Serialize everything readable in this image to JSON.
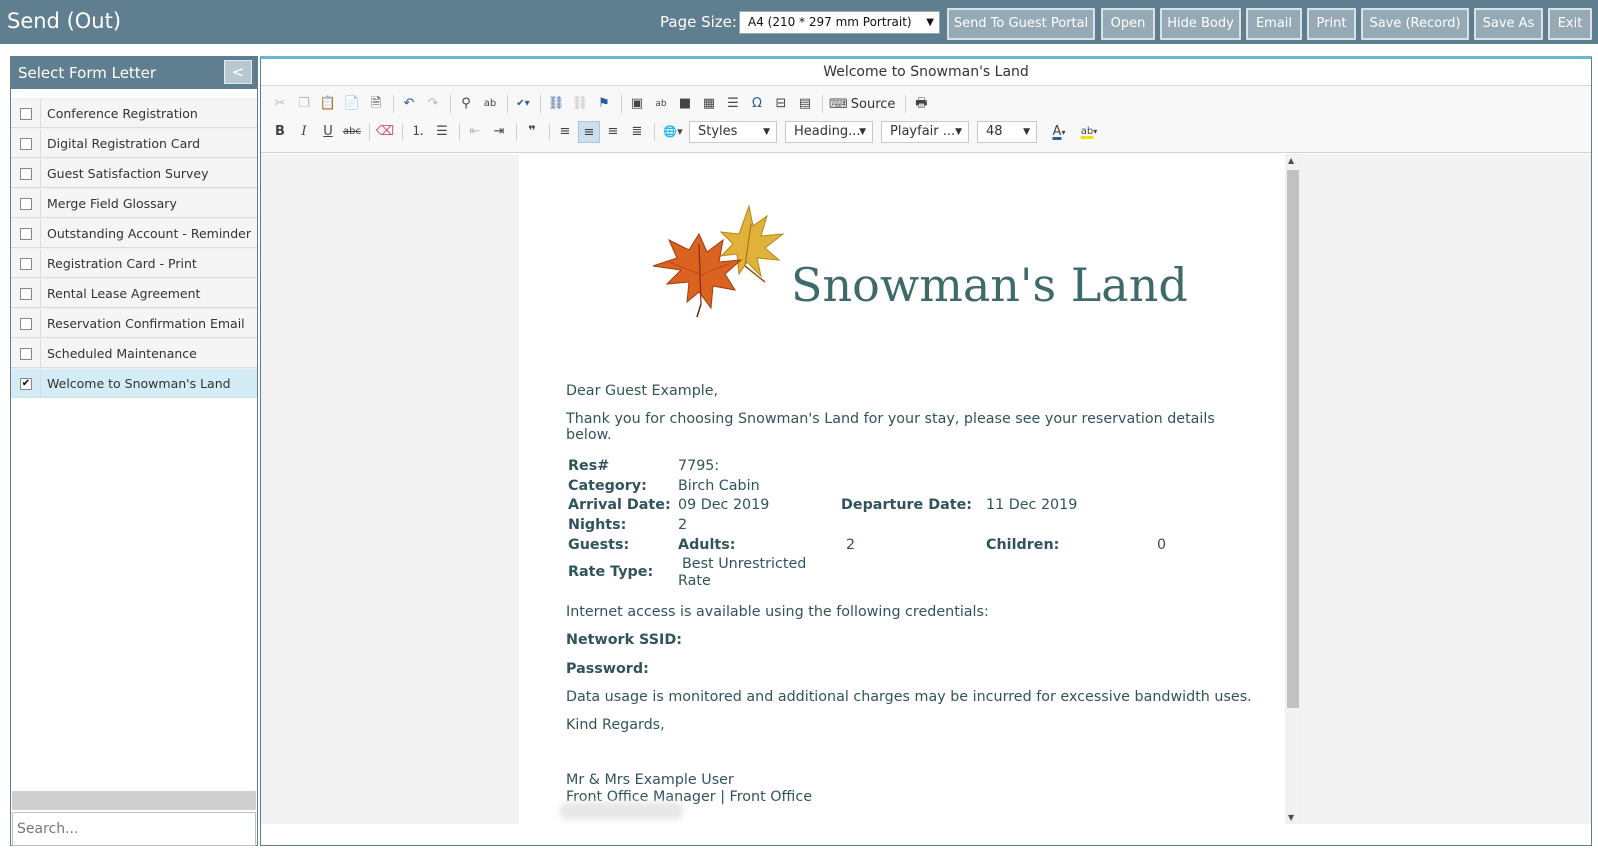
{
  "app": {
    "title": "Send (Out)"
  },
  "header": {
    "page_size_label": "Page Size:",
    "page_size_value": "A4 (210 * 297 mm Portrait)",
    "buttons": {
      "send_to_guest_portal": "Send To Guest Portal",
      "open": "Open",
      "hide_body": "Hide Body",
      "email": "Email",
      "print": "Print",
      "save_record": "Save (Record)",
      "save_as": "Save As",
      "exit": "Exit"
    }
  },
  "sidebar": {
    "title": "Select Form Letter",
    "collapse_label": "<",
    "items": [
      {
        "label": "Conference Registration",
        "checked": false
      },
      {
        "label": "Digital Registration Card",
        "checked": false
      },
      {
        "label": "Guest Satisfaction Survey",
        "checked": false
      },
      {
        "label": "Merge Field Glossary",
        "checked": false
      },
      {
        "label": "Outstanding Account - Reminder",
        "checked": false
      },
      {
        "label": "Registration Card - Print",
        "checked": false
      },
      {
        "label": "Rental Lease Agreement",
        "checked": false
      },
      {
        "label": "Reservation Confirmation Email",
        "checked": false
      },
      {
        "label": "Scheduled Maintenance",
        "checked": false
      },
      {
        "label": "Welcome to Snowman's Land",
        "checked": true
      }
    ],
    "search_placeholder": "Search..."
  },
  "editor": {
    "title": "Welcome to Snowman's Land",
    "toolbar": {
      "source_label": "Source",
      "styles": "Styles",
      "format": "Heading...",
      "font": "Playfair ...",
      "size": "48"
    }
  },
  "document": {
    "logo_text": "Snowman's Land",
    "greeting": "Dear Guest Example,",
    "intro_line1": "Thank you for choosing Snowman's Land for your stay, please see your reservation details",
    "intro_line2": "below.",
    "details": {
      "res_label": "Res#",
      "res_value": "7795:",
      "category_label": "Category:",
      "category_value": "Birch Cabin",
      "arrival_label": "Arrival Date:",
      "arrival_value": "09 Dec 2019",
      "departure_label": "Departure Date:",
      "departure_value": "11 Dec 2019",
      "nights_label": "Nights:",
      "nights_value": "2",
      "guests_label": "Guests:",
      "adults_label": "Adults:",
      "adults_value": "2",
      "children_label": "Children:",
      "children_value": "0",
      "rate_type_label": "Rate Type:",
      "rate_type_line1": "Best Unrestricted",
      "rate_type_line2": "Rate"
    },
    "internet_intro": "Internet access is available using the following credentials:",
    "ssid_label": "Network SSID:",
    "password_label": "Password:",
    "data_usage": "Data usage is monitored and additional charges may be incurred for excessive bandwidth uses.",
    "closing": "Kind Regards,",
    "sender_name": "Mr & Mrs Example User",
    "sender_title": "Front Office Manager | Front Office"
  },
  "colors": {
    "header_bg": "#5f7f91",
    "button_bg": "#96aab5",
    "selected_row": "#d3ecf6",
    "logo_text": "#3f6a6a",
    "body_text": "#31545c"
  }
}
